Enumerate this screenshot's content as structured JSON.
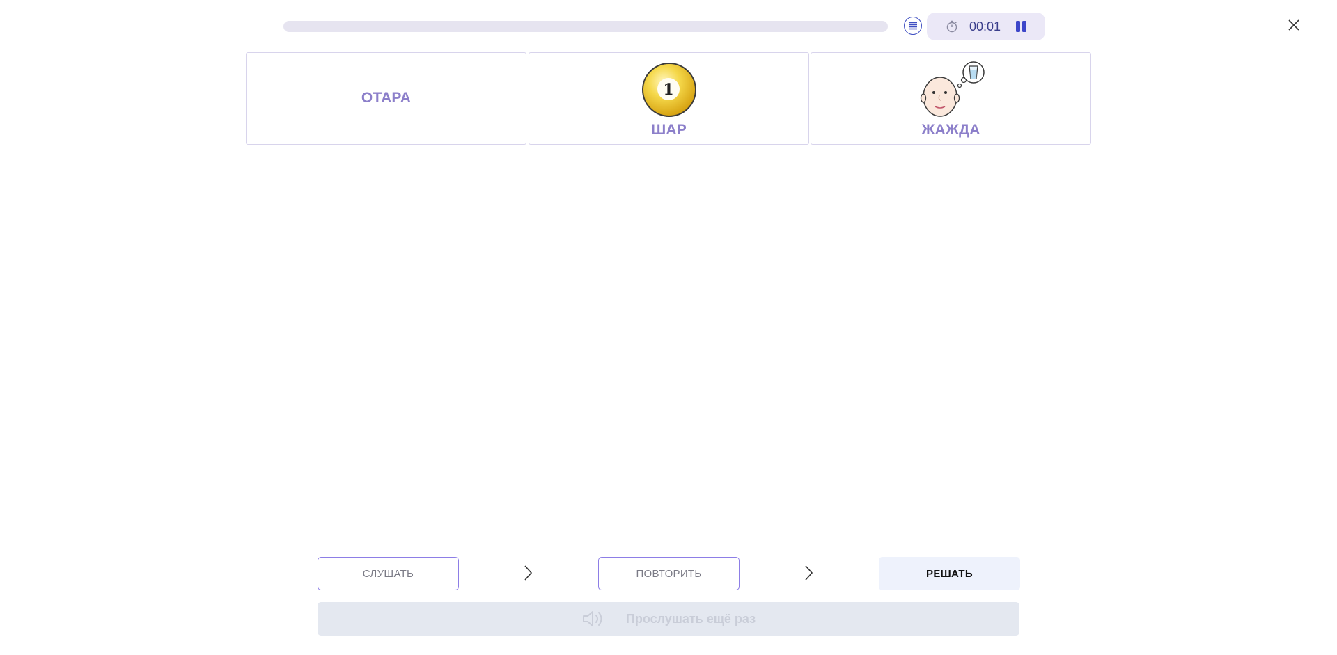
{
  "header": {
    "progress": 0,
    "timer": "00:01",
    "icons": {
      "list": "list-icon",
      "timer": "stopwatch-icon",
      "pause": "pause-icon",
      "close": "close-icon"
    }
  },
  "cards": [
    {
      "label": "ОТАРА",
      "image": null
    },
    {
      "label": "ШАР",
      "image": "billiard-ball-1",
      "ball_number": "1"
    },
    {
      "label": "ЖАЖДА",
      "image": "thirsty-face-thought-glass"
    }
  ],
  "steps": {
    "listen_label": "СЛУШАТЬ",
    "repeat_label": "ПОВТОРИТЬ",
    "solve_label": "РЕШАТЬ"
  },
  "replay": {
    "label": "Прослушать ещё раз",
    "icon": "speaker-icon"
  },
  "colors": {
    "accent": "#8c7fca",
    "timer_bg": "#ebe8f7",
    "pause": "#3d46c9",
    "solve_bg": "#eef2fc",
    "replay_bg": "#e4e8f0"
  }
}
